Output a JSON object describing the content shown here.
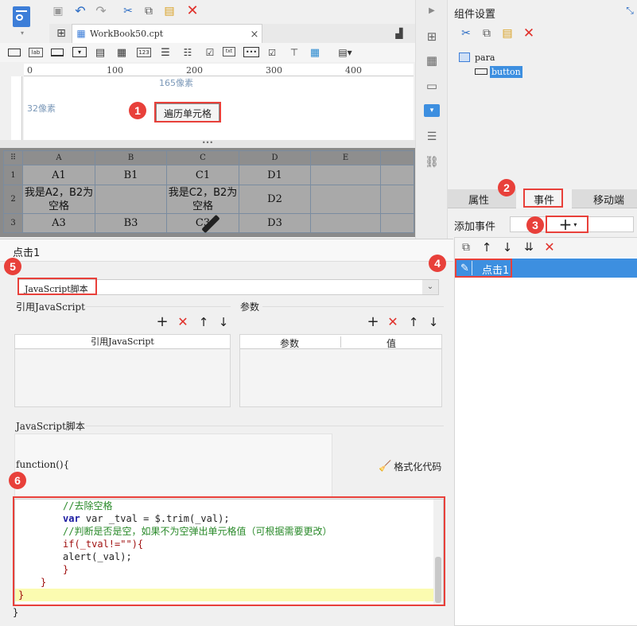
{
  "toolbar": {
    "file_tab": "WorkBook50.cpt",
    "comp_labels": {
      "lab": "lab",
      "n123": "123",
      "txt": "txt"
    }
  },
  "ruler": {
    "ticks": [
      "0",
      "100",
      "200",
      "300",
      "400"
    ]
  },
  "canvas": {
    "width_label": "165像素",
    "height_label": "32像素",
    "button_label": "遍历单元格"
  },
  "sheet": {
    "columns": [
      "A",
      "B",
      "C",
      "D",
      "E"
    ],
    "rows": [
      {
        "num": "1",
        "cells": [
          "A1",
          "B1",
          "C1",
          "D1",
          ""
        ]
      },
      {
        "num": "2",
        "cells": [
          "我是A2，B2为空格",
          "",
          "我是C2，B2为空格",
          "D2",
          ""
        ]
      },
      {
        "num": "3",
        "cells": [
          "A3",
          "B3",
          "C3",
          "D3",
          ""
        ]
      }
    ]
  },
  "right_panel": {
    "title": "组件设置",
    "tree": {
      "root": "para",
      "child": "button"
    },
    "tabs": {
      "property": "属性",
      "event": "事件",
      "mobile": "移动端"
    },
    "add_event_label": "添加事件",
    "add_event_glyph": "+",
    "events": [
      {
        "name": "点击1"
      }
    ]
  },
  "editor": {
    "title": "点击1",
    "type_selected": "JavaScript脚本",
    "ref_js_section": "引用JavaScript",
    "params_section": "参数",
    "ref_table_header": "引用JavaScript",
    "params_headers": [
      "参数",
      "值"
    ],
    "script_section": "JavaScript脚本",
    "function_sig": "function(){",
    "format_btn": "格式化代码",
    "code": {
      "l1": "//去除空格",
      "l2": "var _tval = $.trim(_val);",
      "l3": "//判断是否是空，如果不为空弹出单元格值（可根据需要更改）",
      "l4": "if(_tval!=\"\"){",
      "l5": "alert(_val);",
      "l6": "}",
      "l7": "}",
      "l8": "}"
    },
    "close_brace": "}"
  },
  "badges": [
    "1",
    "2",
    "3",
    "4",
    "5",
    "6"
  ],
  "colors": {
    "accent": "#e8403a",
    "selection": "#3d8fe0",
    "code_comment": "#2a8a2a",
    "code_keyword": "#1a1aa0",
    "current_line": "#fbfbb0"
  }
}
